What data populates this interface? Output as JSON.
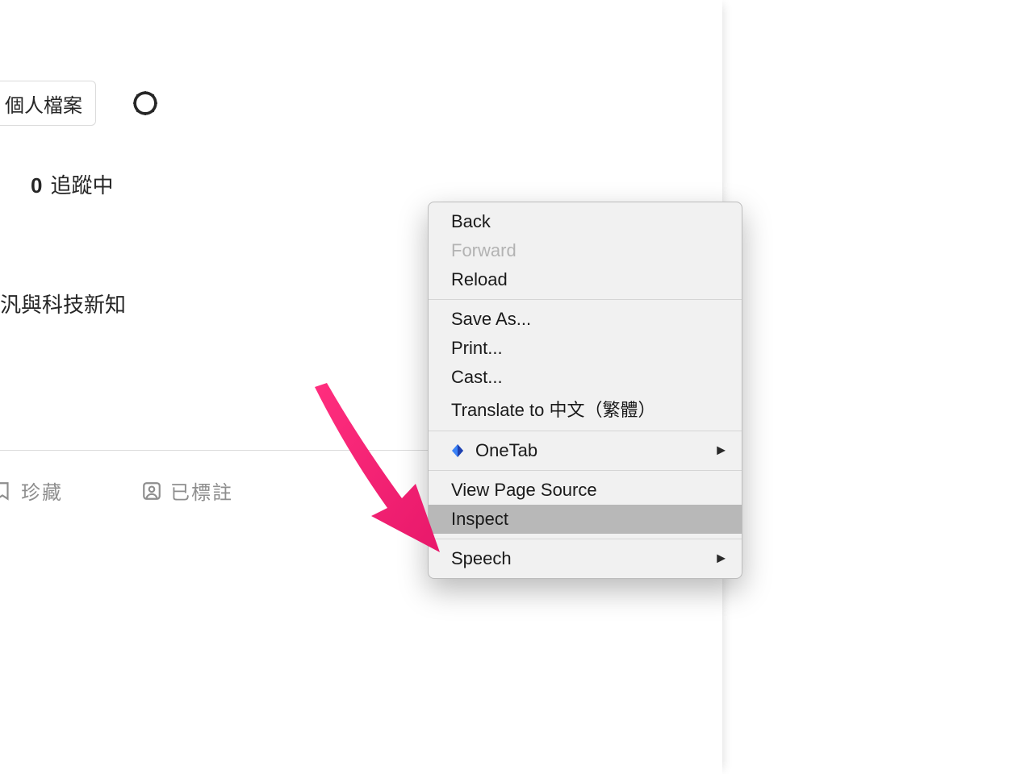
{
  "profile": {
    "edit_button": "個人檔案",
    "stat_count": "0",
    "stat_label": "追蹤中",
    "bio_fragment": "汎與科技新知"
  },
  "tabs": {
    "saved": "珍藏",
    "tagged": "已標註"
  },
  "context_menu": {
    "back": "Back",
    "forward": "Forward",
    "reload": "Reload",
    "save_as": "Save As...",
    "print": "Print...",
    "cast": "Cast...",
    "translate": "Translate to 中文（繁體）",
    "onetab": "OneTab",
    "view_source": "View Page Source",
    "inspect": "Inspect",
    "speech": "Speech"
  }
}
